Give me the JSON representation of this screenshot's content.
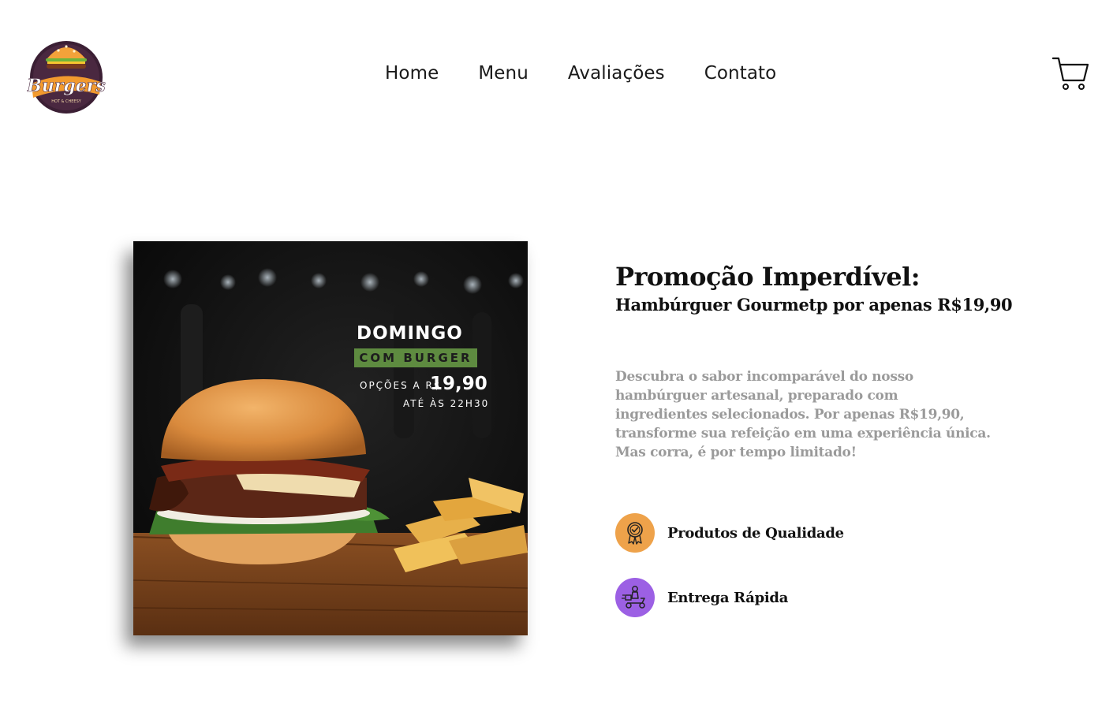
{
  "brand": {
    "logo_name": "Burgers",
    "logo_tagline": "HOT & CHEESY"
  },
  "nav": {
    "items": [
      {
        "label": "Home"
      },
      {
        "label": "Menu"
      },
      {
        "label": "Avaliações"
      },
      {
        "label": "Contato"
      }
    ]
  },
  "header": {
    "cart_icon": "shopping-cart-icon"
  },
  "promo_image": {
    "line1": "DOMINGO",
    "line2": "COM BURGER",
    "options_label": "OPÇÕES A R$",
    "price": "19,90",
    "until": "ATÉ ÀS 22H30"
  },
  "promo": {
    "title": "Promoção Imperdível:",
    "subtitle": "Hambúrguer Gourmetp por apenas R$19,90",
    "description": "Descubra o sabor incomparável do nosso hambúrguer artesanal, preparado com ingredientes selecionados. Por apenas R$19,90, transforme sua refeição em uma experiência única. Mas corra, é por tempo limitado!"
  },
  "features": [
    {
      "label": "Produtos de Qualidade",
      "icon": "quality-badge-icon",
      "color": "#eea24a"
    },
    {
      "label": "Entrega Rápida",
      "icon": "delivery-scooter-icon",
      "color": "#9c60e4"
    }
  ],
  "colors": {
    "text": "#111111",
    "muted": "#9a9a9a",
    "accent_green": "#5e8b40"
  }
}
